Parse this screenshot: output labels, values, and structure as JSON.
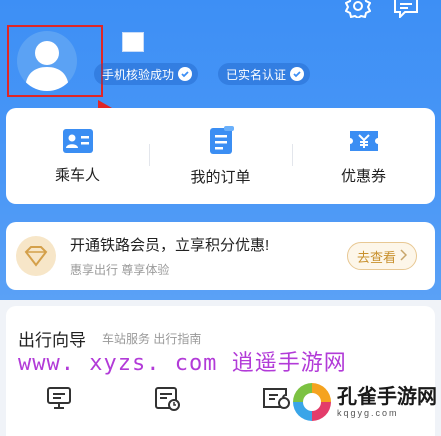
{
  "header": {
    "verify_badges": [
      {
        "label": "手机核验成功"
      },
      {
        "label": "已实名认证"
      }
    ]
  },
  "quick_actions": [
    {
      "label": "乘车人",
      "icon": "passenger-card-icon"
    },
    {
      "label": "我的订单",
      "icon": "order-document-icon"
    },
    {
      "label": "优惠券",
      "icon": "coupon-ticket-icon"
    }
  ],
  "member": {
    "title": "开通铁路会员，立享积分优惠!",
    "subtitle": "惠享出行 尊享体验",
    "button_label": "去查看"
  },
  "guide": {
    "title": "出行向导",
    "tags": "车站服务 出行指南",
    "icons": [
      "screen-icon",
      "schedule-icon",
      "ticket-clock-icon"
    ]
  },
  "watermark": {
    "url": "www. xyzs. com",
    "cn": "逍遥手游网",
    "logo_main": "孔雀手游网",
    "logo_sub": "kqgyg.com"
  },
  "colors": {
    "header_blue": "#3d8ff5",
    "accent_blue": "#3b8ef3",
    "gold": "#c8902d",
    "highlight_red": "#e02626"
  }
}
